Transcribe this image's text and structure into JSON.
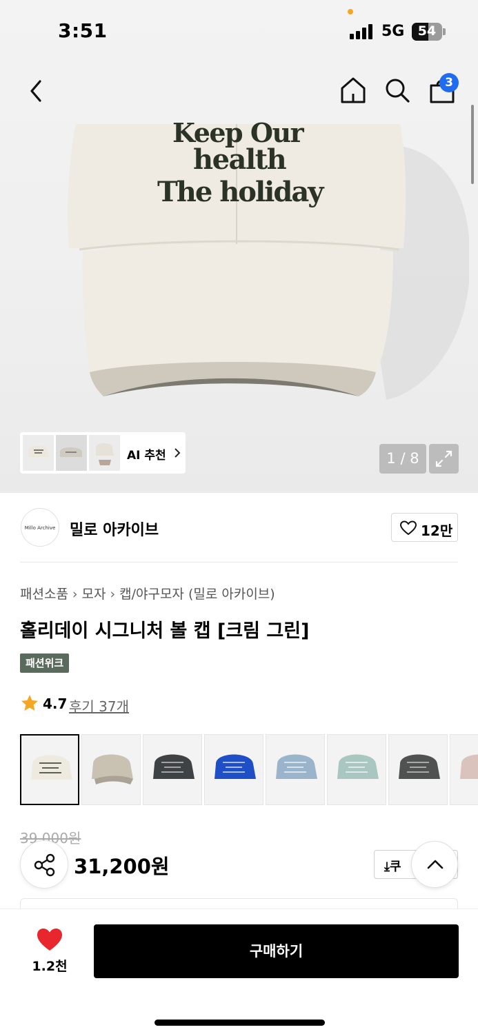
{
  "status_bar": {
    "time": "3:51",
    "network": "5G",
    "battery": "54"
  },
  "nav": {
    "cart_count": "3"
  },
  "hero": {
    "cap_text": [
      "Keep Our",
      "health",
      "The holiday"
    ],
    "ai_label": "AI 추천",
    "counter": "1 / 8"
  },
  "store": {
    "logo_text": "Millo Archive",
    "name": "밀로 아카이브",
    "likes": "12만"
  },
  "breadcrumb": [
    "패션소품",
    "모자",
    "캡/야구모자 (밀로 아카이브)"
  ],
  "product": {
    "title": "홀리데이 시그니처 볼 캡 [크림 그린]",
    "tag": "패션위크",
    "rating": "4.7",
    "reviews": "후기 37개",
    "original_price": "39,000원",
    "price": "31,200원",
    "coupon_label": "쿠"
  },
  "swatch_colors": [
    "#efeae0",
    "#c9c1b2",
    "#3f4245",
    "#1f4fc7",
    "#9ab4cc",
    "#a9c6c0",
    "#505252",
    "#d9c3bc"
  ],
  "bottom": {
    "like_count": "1.2천",
    "buy_label": "구매하기"
  },
  "colors": {
    "accent_blue": "#1f6cf0",
    "heart_red": "#e8262d",
    "tag_green": "#5a6a5c",
    "star": "#f5a623"
  }
}
